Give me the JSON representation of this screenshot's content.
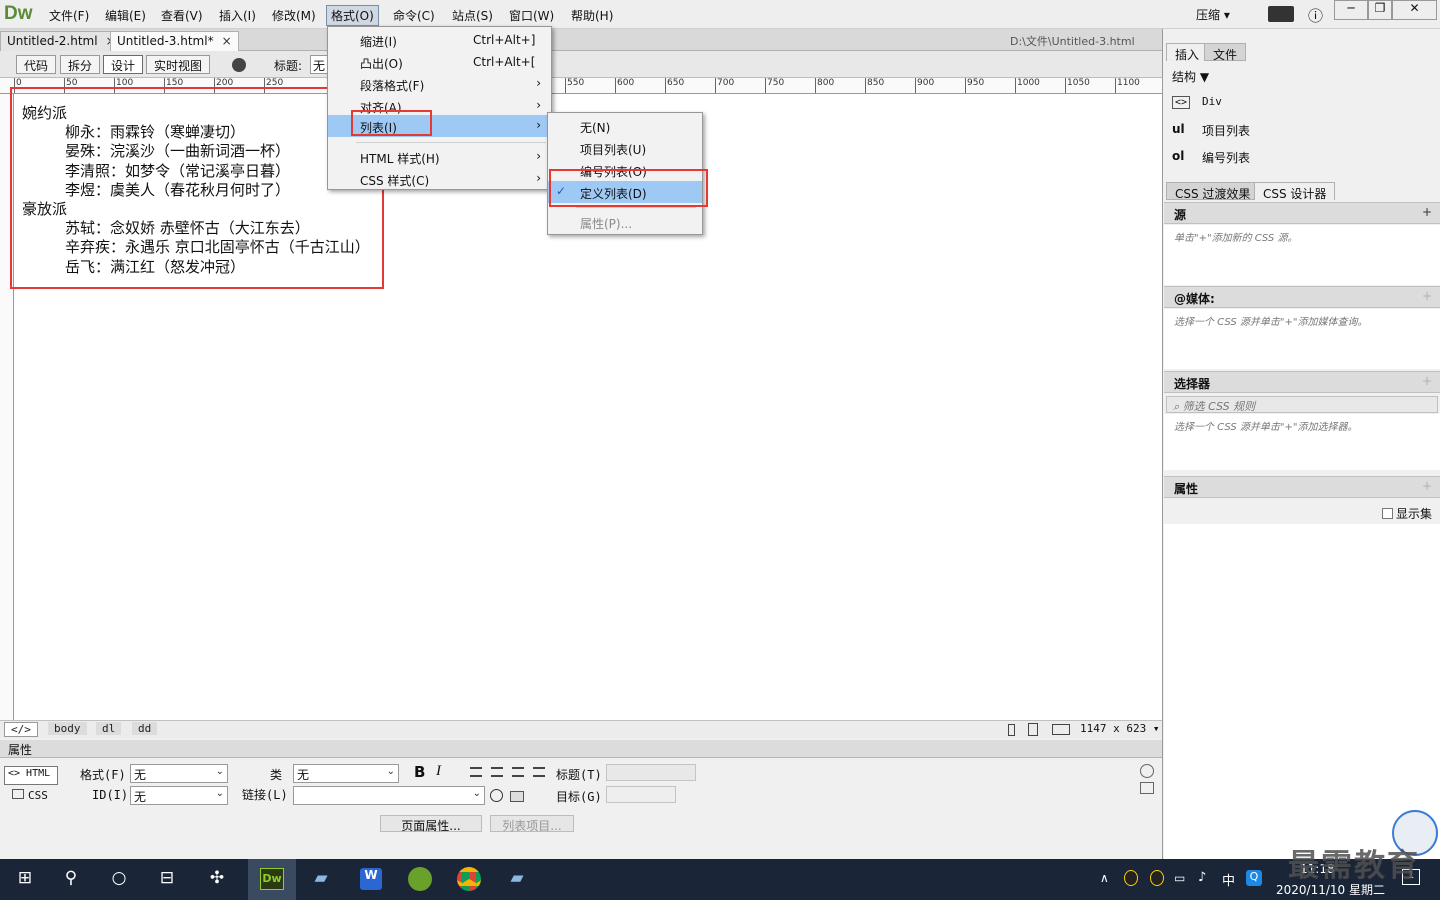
{
  "app": {
    "logo": "Dw"
  },
  "menubar": {
    "items": [
      "文件(F)",
      "编辑(E)",
      "查看(V)",
      "插入(I)",
      "修改(M)",
      "格式(O)",
      "命令(C)",
      "站点(S)",
      "窗口(W)",
      "帮助(H)"
    ],
    "active": "格式(O)",
    "compress_label": "压缩",
    "compress_arrow": "▾"
  },
  "window_controls": {
    "minimize": "─",
    "restore": "❐",
    "close": "✕",
    "info": "ⓘ"
  },
  "tabs": [
    {
      "label": "Untitled-2.html",
      "close": "×"
    },
    {
      "label": "Untitled-3.html*",
      "close": "×"
    }
  ],
  "doc_path": "D:\\文件\\Untitled-3.html",
  "toolbar": {
    "code": "代码",
    "split": "拆分",
    "design": "设计",
    "live": "实时视图",
    "title_label": "标题:",
    "title_value": "无"
  },
  "ruler_ticks": [
    "0",
    "50",
    "100",
    "150",
    "200",
    "250",
    "550",
    "600",
    "650",
    "700",
    "750",
    "800",
    "850",
    "900",
    "950",
    "1000",
    "1050",
    "1100"
  ],
  "document": {
    "groups": [
      {
        "term": "婉约派",
        "items": [
          "柳永：雨霖铃（寒蝉凄切）",
          "晏殊：浣溪沙（一曲新词酒一杯）",
          "李清照：如梦令（常记溪亭日暮）",
          "李煜：虞美人（春花秋月何时了）"
        ]
      },
      {
        "term": "豪放派",
        "items": [
          "苏轼：念奴娇 赤壁怀古（大江东去）",
          "辛弃疾：永遇乐 京口北固亭怀古（千古江山）",
          "岳飞：满江红（怒发冲冠）"
        ]
      }
    ]
  },
  "format_menu": {
    "items": [
      {
        "label": "缩进(I)",
        "shortcut": "Ctrl+Alt+]"
      },
      {
        "label": "凸出(O)",
        "shortcut": "Ctrl+Alt+["
      },
      {
        "label": "段落格式(F)",
        "arrow": "›"
      },
      {
        "label": "对齐(A)",
        "arrow": "›"
      },
      {
        "label": "列表(I)",
        "arrow": "›"
      },
      {
        "label": "HTML 样式(H)",
        "arrow": "›"
      },
      {
        "label": "CSS 样式(C)",
        "arrow": "›"
      }
    ]
  },
  "list_submenu": {
    "items": [
      "无(N)",
      "项目列表(U)",
      "编号列表(O)",
      "定义列表(D)",
      "属性(P)..."
    ],
    "checked": "定义列表(D)",
    "check_mark": "✓"
  },
  "tagbar": {
    "code_icon": "</>",
    "tags": [
      "body",
      "dl",
      "dd"
    ],
    "size": "1147 x 623",
    "size_arrow": "▾"
  },
  "properties": {
    "header": "属性",
    "html_btn": "<> HTML",
    "css_btn": "CSS",
    "format_label": "格式(F)",
    "format_value": "无",
    "id_label": "ID(I)",
    "id_value": "无",
    "class_label": "类",
    "class_value": "无",
    "link_label": "链接(L)",
    "link_value": "",
    "bold": "B",
    "italic": "I",
    "title_label": "标题(T)",
    "target_label": "目标(G)",
    "page_props": "页面属性...",
    "list_item": "列表项目..."
  },
  "right_panel": {
    "tabs1": [
      "插入",
      "文件"
    ],
    "structure": "结构",
    "structure_arrow": "▼",
    "insert_items": [
      {
        "icon": "<>",
        "label": "Div"
      },
      {
        "icon": "ul",
        "label": "项目列表"
      },
      {
        "icon": "ol",
        "label": "编号列表"
      }
    ],
    "tabs2": [
      "CSS 过渡效果",
      "CSS 设计器"
    ],
    "sections": [
      {
        "title": "源",
        "hint": "单击\"+\"添加新的 CSS 源。"
      },
      {
        "title": "@媒体:",
        "hint": "选择一个 CSS 源并单击\"+\"添加媒体查询。"
      },
      {
        "title": "选择器",
        "filter": "筛选 CSS 规则",
        "hint": "选择一个 CSS 源并单击\"+\"添加选择器。"
      },
      {
        "title": "属性",
        "show_set": "显示集"
      }
    ],
    "plus": "+",
    "minus": "−"
  },
  "taskbar": {
    "time": "11:18",
    "date": "2020/11/10 星期二",
    "ime": "中",
    "watermark": "最需教育",
    "notify_count": "1"
  }
}
